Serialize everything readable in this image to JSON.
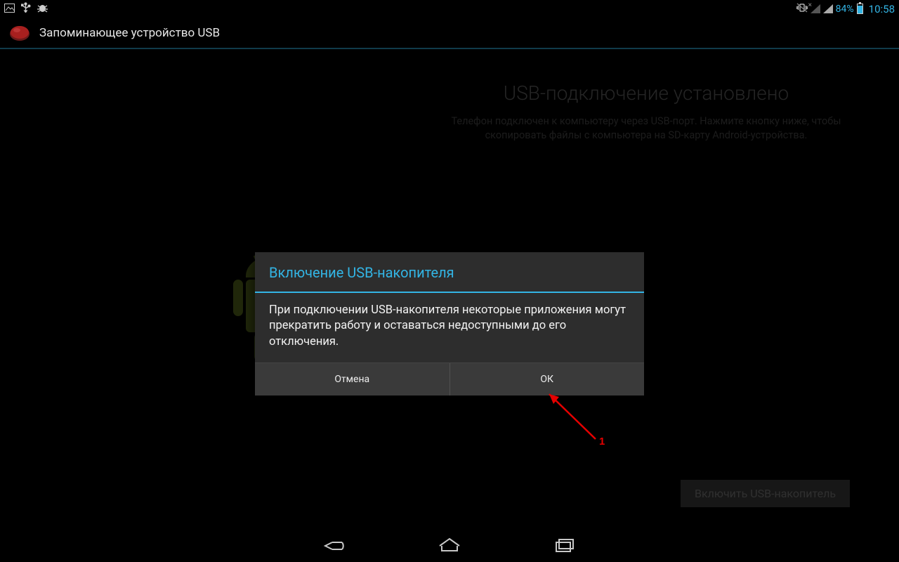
{
  "statusbar": {
    "battery_pct": "84%",
    "clock": "10:58"
  },
  "actionbar": {
    "title": "Запоминающее устройство USB"
  },
  "background": {
    "title": "USB-подключение установлено",
    "description": "Телефон подключен к компьютеру через USB-порт. Нажмите кнопку ниже, чтобы скопировать файлы с компьютера на SD-карту Android-устройства.",
    "button": "Включить USB-накопитель"
  },
  "dialog": {
    "title": "Включение USB-накопителя",
    "body": "При подключении USB-накопителя некоторые приложения могут прекратить работу и оставаться недоступными до его отключения.",
    "cancel": "Отмена",
    "ok": "ОК"
  },
  "callout": {
    "label": "1"
  }
}
